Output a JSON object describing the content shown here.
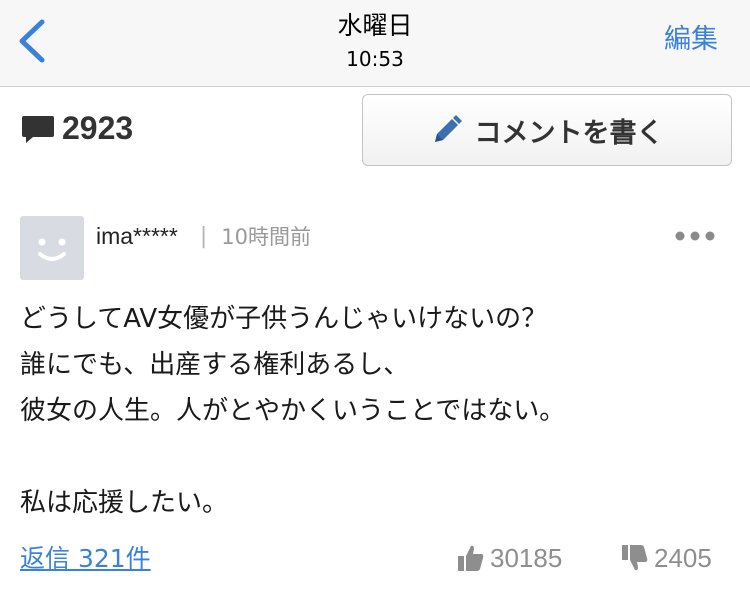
{
  "navbar": {
    "back_icon": "chevron-left-icon",
    "title": "水曜日",
    "time": "10:53",
    "edit_label": "編集"
  },
  "comments_header": {
    "icon": "comment-bubble-icon",
    "count": "2923",
    "write_button_icon": "pencil-icon",
    "write_button_label": "コメントを書く"
  },
  "comment": {
    "avatar_icon": "smiley-avatar-icon",
    "username": "ima*****",
    "separator": "|",
    "time_ago": "10時間前",
    "more_icon": "more-dots-icon",
    "body_lines": [
      "どうしてAV女優が子供うんじゃいけないの？",
      "誰にでも、出産する権利あるし、",
      "彼女の人生。人がとやかくいうことではない。",
      "",
      "私は応援したい。"
    ],
    "replies_label": "返信 321件",
    "likes": "30185",
    "dislikes": "2405"
  },
  "colors": {
    "accent": "#3a82d9",
    "navbar_bg": "#f7f7f7",
    "text": "#1a1a1a",
    "muted": "#8e8e8e",
    "avatar_bg": "#d9dbe3"
  }
}
